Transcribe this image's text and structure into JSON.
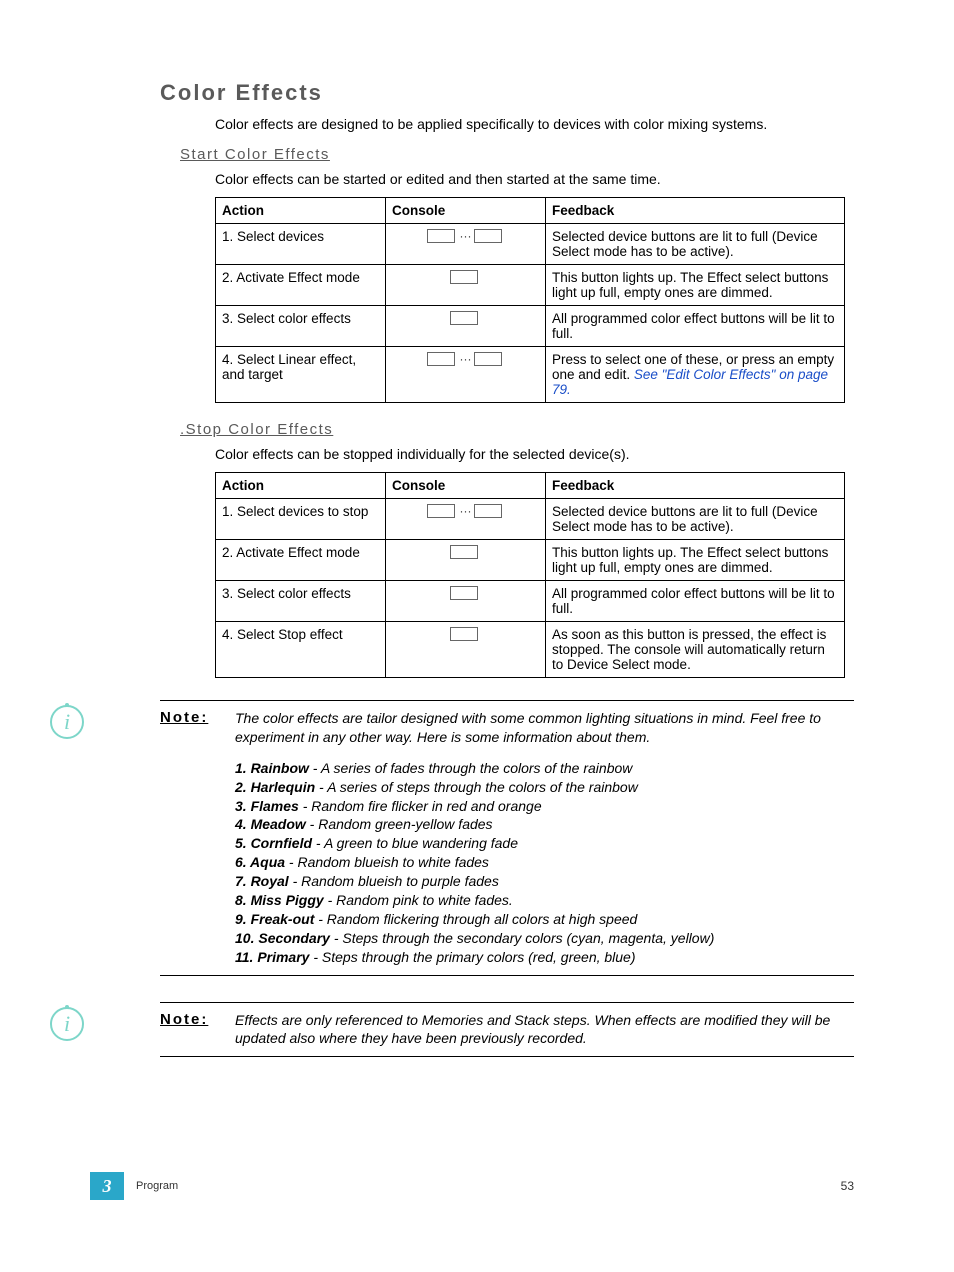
{
  "headings": {
    "main": "Color Effects",
    "start": "Start Color Effects",
    "stop": ".Stop Color Effects"
  },
  "paragraphs": {
    "main_intro": "Color effects are designed to be applied specifically to devices with color mixing systems.",
    "start_intro": "Color effects can be started or edited and then started at the same time.",
    "stop_intro": "Color effects can be stopped individually for the selected device(s)."
  },
  "table_headers": {
    "action": "Action",
    "console": "Console",
    "feedback": "Feedback"
  },
  "start_table": [
    {
      "action": "1. Select devices",
      "console_style": "double",
      "feedback": "Selected device buttons are lit to full (Device Select mode has to be active)."
    },
    {
      "action": "2. Activate Effect mode",
      "console_style": "single",
      "feedback": "This button lights up. The Effect select buttons light up full, empty ones are dimmed."
    },
    {
      "action": "3. Select color effects",
      "console_style": "single",
      "feedback": "All programmed color effect buttons will be lit to full."
    },
    {
      "action": "4. Select Linear effect, and target",
      "console_style": "double",
      "feedback": "Press to select one of these, or press an empty one and edit. ",
      "see_link": "See \"Edit Color Effects\" on page 79."
    }
  ],
  "stop_table": [
    {
      "action": "1. Select devices to stop",
      "console_style": "double",
      "feedback": "Selected device buttons are lit to full (Device Select mode has to be active)."
    },
    {
      "action": "2. Activate Effect mode",
      "console_style": "single",
      "feedback": "This button lights up. The Effect select buttons light up full, empty ones are dimmed."
    },
    {
      "action": "3. Select color effects",
      "console_style": "single",
      "feedback": "All programmed color effect buttons will be lit to full."
    },
    {
      "action": "4. Select Stop effect",
      "console_style": "single",
      "feedback": "As soon as this button is pressed, the effect is stopped. The console will automatically return to Device Select mode."
    }
  ],
  "note1": {
    "label": "Note:",
    "body": "The color effects are tailor designed with some common lighting situations in mind. Feel free to experiment in any other way. Here is some information about them.",
    "list": [
      {
        "n": "1.",
        "name": "Rainbow",
        "desc": " - A series of fades through the colors of the rainbow"
      },
      {
        "n": "2.",
        "name": "Harlequin",
        "desc": " - A series of steps through the colors of the rainbow"
      },
      {
        "n": "3.",
        "name": "Flames",
        "desc": " - Random fire flicker in red and orange"
      },
      {
        "n": "4.",
        "name": "Meadow",
        "desc": " - Random green-yellow fades"
      },
      {
        "n": "5.",
        "name": "Cornfield",
        "desc": " - A green to blue wandering fade"
      },
      {
        "n": "6.",
        "name": "Aqua",
        "desc": " - Random blueish to white fades"
      },
      {
        "n": "7.",
        "name": "Royal",
        "desc": " - Random blueish to purple fades"
      },
      {
        "n": "8.",
        "name": "Miss Piggy",
        "desc": " - Random pink to white fades."
      },
      {
        "n": "9.",
        "name": "Freak-out",
        "desc": " - Random flickering through all colors at high speed"
      },
      {
        "n": "10.",
        "name": "Secondary",
        "desc": " - Steps through the secondary colors (cyan, magenta, yellow)"
      },
      {
        "n": "11.",
        "name": "Primary",
        "desc": " - Steps through the primary colors (red, green, blue)"
      }
    ]
  },
  "note2": {
    "label": "Note:",
    "body": "Effects are only referenced to Memories and Stack steps. When effects are modified they will be updated also where they have been previously recorded."
  },
  "footer": {
    "chapter": "3",
    "section": "Program",
    "page": "53"
  }
}
